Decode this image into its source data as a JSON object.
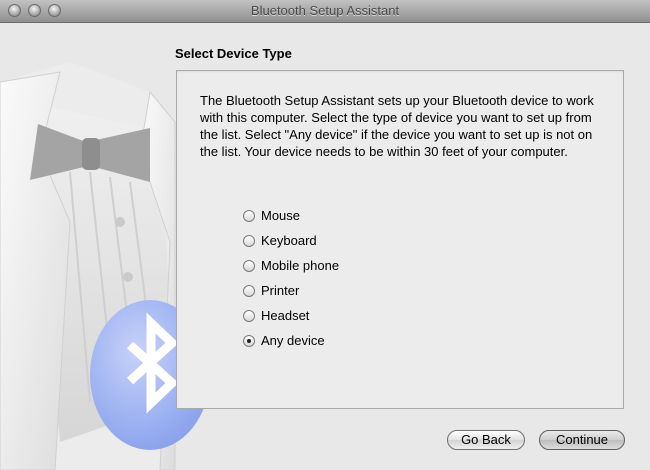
{
  "window": {
    "title": "Bluetooth Setup Assistant"
  },
  "page": {
    "heading": "Select Device Type",
    "description": "The Bluetooth Setup Assistant sets up your Bluetooth device to work with this computer. Select the type of device you want to set up from the list. Select \"Any device\" if the device you want to set up is not on the list. Your device needs to be within 30 feet of your computer."
  },
  "device_types": [
    {
      "label": "Mouse",
      "selected": false
    },
    {
      "label": "Keyboard",
      "selected": false
    },
    {
      "label": "Mobile phone",
      "selected": false
    },
    {
      "label": "Printer",
      "selected": false
    },
    {
      "label": "Headset",
      "selected": false
    },
    {
      "label": "Any device",
      "selected": true
    }
  ],
  "buttons": {
    "back": "Go Back",
    "continue": "Continue"
  },
  "colors": {
    "bluetooth_blue": "#8fa6f0"
  }
}
